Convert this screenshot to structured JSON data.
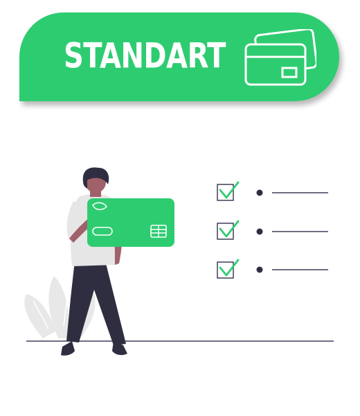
{
  "banner": {
    "title": "STANDART",
    "icon": "credit-cards-icon"
  },
  "colors": {
    "accent": "#2ecc71",
    "text_on_accent": "#ffffff",
    "dark": "#2f2e41",
    "line": "#3f3d56",
    "leaf": "#e8e8e8"
  },
  "checklist": {
    "items": [
      "",
      "",
      ""
    ],
    "checked": [
      true,
      true,
      true
    ]
  }
}
